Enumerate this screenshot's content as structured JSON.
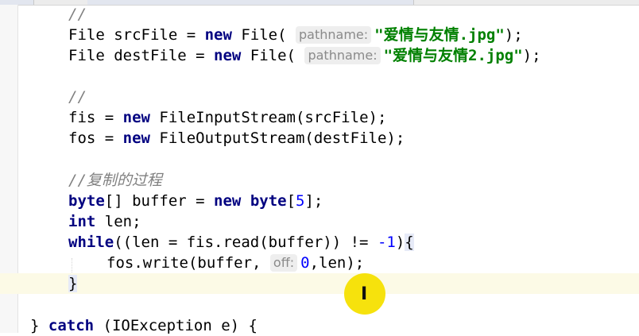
{
  "code": {
    "l1_comment": "//",
    "l2_a": "File srcFile = ",
    "l2_kw": "new",
    "l2_b": " File(",
    "l2_hint": "pathname:",
    "l2_str": "\"爱情与友情.jpg\"",
    "l2_end": ");",
    "l3_a": "File destFile = ",
    "l3_kw": "new",
    "l3_b": " File(",
    "l3_hint": "pathname:",
    "l3_str": "\"爱情与友情2.jpg\"",
    "l3_end": ");",
    "l5_comment": "//",
    "l6_a": "fis = ",
    "l6_kw": "new",
    "l6_b": " FileInputStream(srcFile);",
    "l7_a": "fos = ",
    "l7_kw": "new",
    "l7_b": " FileOutputStream(destFile);",
    "l9_comment": "//复制的过程",
    "l10_kw1": "byte",
    "l10_a": "[] buffer = ",
    "l10_kw2": "new",
    "l10_kw3": " byte",
    "l10_b": "[",
    "l10_num": "5",
    "l10_c": "];",
    "l11_kw": "int",
    "l11_a": " len;",
    "l12_kw": "while",
    "l12_a": "((len = fis.read(buffer)) != ",
    "l12_num": "-1",
    "l12_b": ")",
    "l12_brace": "{",
    "l13_a": "fos.write(buffer, ",
    "l13_hint": "off:",
    "l13_num": "0",
    "l13_b": ",len);",
    "l14_brace": "}",
    "l16_a": "} ",
    "l16_kw": "catch",
    "l16_b": " (IOException e) {"
  },
  "cursor_icon": "text-ibeam-icon",
  "highlight_color": "#f5e000"
}
